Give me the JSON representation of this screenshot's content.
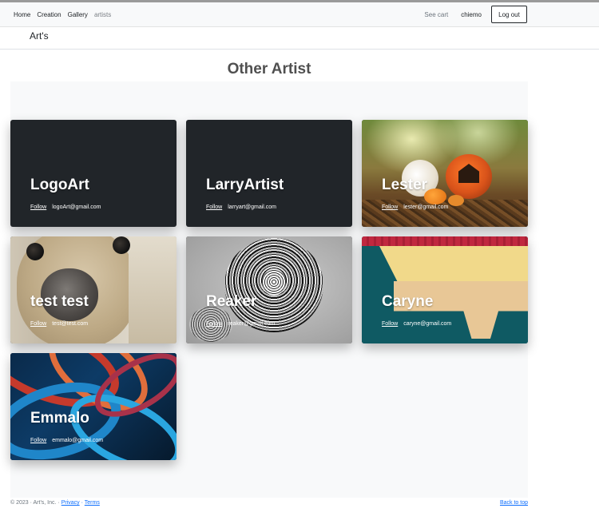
{
  "nav": {
    "links": [
      "Home",
      "Creation",
      "Gallery",
      "artists"
    ],
    "see_cart": "See cart",
    "username": "chiemo",
    "logout_label": "Log out"
  },
  "brand": "Art's",
  "page_title": "Other Artist",
  "follow_label": "Follow",
  "cards": [
    {
      "name": "LogoArt",
      "email": "logoArt@gmail.com",
      "image": "none"
    },
    {
      "name": "LarryArtist",
      "email": "larryart@gmail.com",
      "image": "none"
    },
    {
      "name": "Lester",
      "email": "lester@gmail.com",
      "image": "halloween-pumpkins"
    },
    {
      "name": "test test",
      "email": "test@test.com",
      "image": "dog-closeup"
    },
    {
      "name": "Reaker",
      "email": "reaker@gmail.com",
      "image": "tree-rings"
    },
    {
      "name": "Caryne",
      "email": "caryne@gmail.com",
      "image": "colorful-architecture"
    },
    {
      "name": "Emmalo",
      "email": "emmalo@gmail.com",
      "image": "fluid-paint"
    }
  ],
  "footer": {
    "copyright": "© 2023 · Art's, Inc. ·",
    "privacy": "Privacy",
    "separator": "·",
    "terms": "Terms",
    "back_to_top": "Back to top"
  },
  "colors": {
    "navbar_bg": "#f8f9fa",
    "card_dark": "#212529",
    "link_blue": "#0d6efd"
  }
}
